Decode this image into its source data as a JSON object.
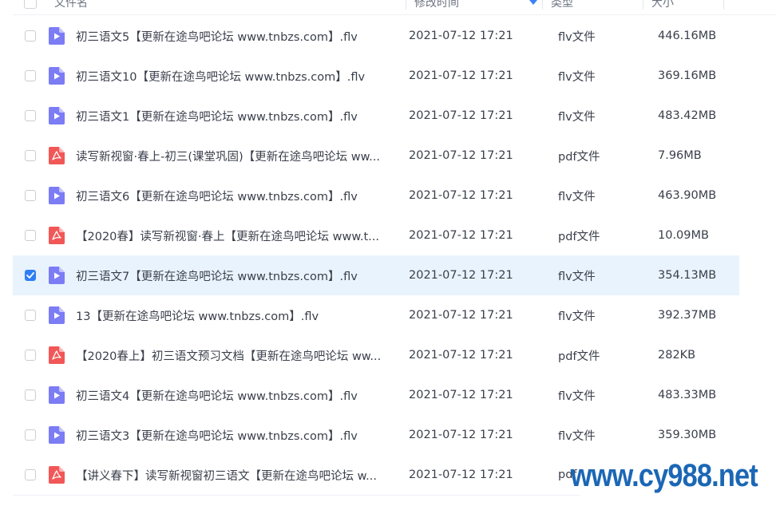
{
  "header": {
    "name_label": "文件名",
    "time_label": "修改时间",
    "type_label": "类型",
    "size_label": "大小"
  },
  "colors": {
    "video_icon": "#7c7cf5",
    "pdf_icon": "#f25757",
    "selected_row": "#e9f3fd",
    "checkbox_checked": "#2f7ff6",
    "watermark": "#1b67b5"
  },
  "files": [
    {
      "name": "初三语文5【更新在途鸟吧论坛 www.tnbzs.com】.flv",
      "time": "2021-07-12 17:21",
      "type": "flv文件",
      "size": "446.16MB",
      "icon": "video-file-icon",
      "selected": false
    },
    {
      "name": "初三语文10【更新在途鸟吧论坛 www.tnbzs.com】.flv",
      "time": "2021-07-12 17:21",
      "type": "flv文件",
      "size": "369.16MB",
      "icon": "video-file-icon",
      "selected": false
    },
    {
      "name": "初三语文1【更新在途鸟吧论坛 www.tnbzs.com】.flv",
      "time": "2021-07-12 17:21",
      "type": "flv文件",
      "size": "483.42MB",
      "icon": "video-file-icon",
      "selected": false
    },
    {
      "name": "读写新视窗·春上-初三(课堂巩固)【更新在途鸟吧论坛 ww...",
      "time": "2021-07-12 17:21",
      "type": "pdf文件",
      "size": "7.96MB",
      "icon": "pdf-file-icon",
      "selected": false
    },
    {
      "name": "初三语文6【更新在途鸟吧论坛 www.tnbzs.com】.flv",
      "time": "2021-07-12 17:21",
      "type": "flv文件",
      "size": "463.90MB",
      "icon": "video-file-icon",
      "selected": false
    },
    {
      "name": "【2020春】读写新视窗·春上【更新在途鸟吧论坛 www.t...",
      "time": "2021-07-12 17:21",
      "type": "pdf文件",
      "size": "10.09MB",
      "icon": "pdf-file-icon",
      "selected": false
    },
    {
      "name": "初三语文7【更新在途鸟吧论坛 www.tnbzs.com】.flv",
      "time": "2021-07-12 17:21",
      "type": "flv文件",
      "size": "354.13MB",
      "icon": "video-file-icon",
      "selected": true
    },
    {
      "name": "13【更新在途鸟吧论坛 www.tnbzs.com】.flv",
      "time": "2021-07-12 17:21",
      "type": "flv文件",
      "size": "392.37MB",
      "icon": "video-file-icon",
      "selected": false
    },
    {
      "name": "【2020春上】初三语文预习文档【更新在途鸟吧论坛 ww...",
      "time": "2021-07-12 17:21",
      "type": "pdf文件",
      "size": "282KB",
      "icon": "pdf-file-icon",
      "selected": false
    },
    {
      "name": "初三语文4【更新在途鸟吧论坛 www.tnbzs.com】.flv",
      "time": "2021-07-12 17:21",
      "type": "flv文件",
      "size": "483.33MB",
      "icon": "video-file-icon",
      "selected": false
    },
    {
      "name": "初三语文3【更新在途鸟吧论坛 www.tnbzs.com】.flv",
      "time": "2021-07-12 17:21",
      "type": "flv文件",
      "size": "359.30MB",
      "icon": "video-file-icon",
      "selected": false
    },
    {
      "name": "【讲义春下】读写新视窗初三语文【更新在途鸟吧论坛 w...",
      "time": "2021-07-12 17:21",
      "type": "pdf",
      "size": "",
      "icon": "pdf-file-icon",
      "selected": false
    }
  ],
  "watermark": "www.cy988.net"
}
